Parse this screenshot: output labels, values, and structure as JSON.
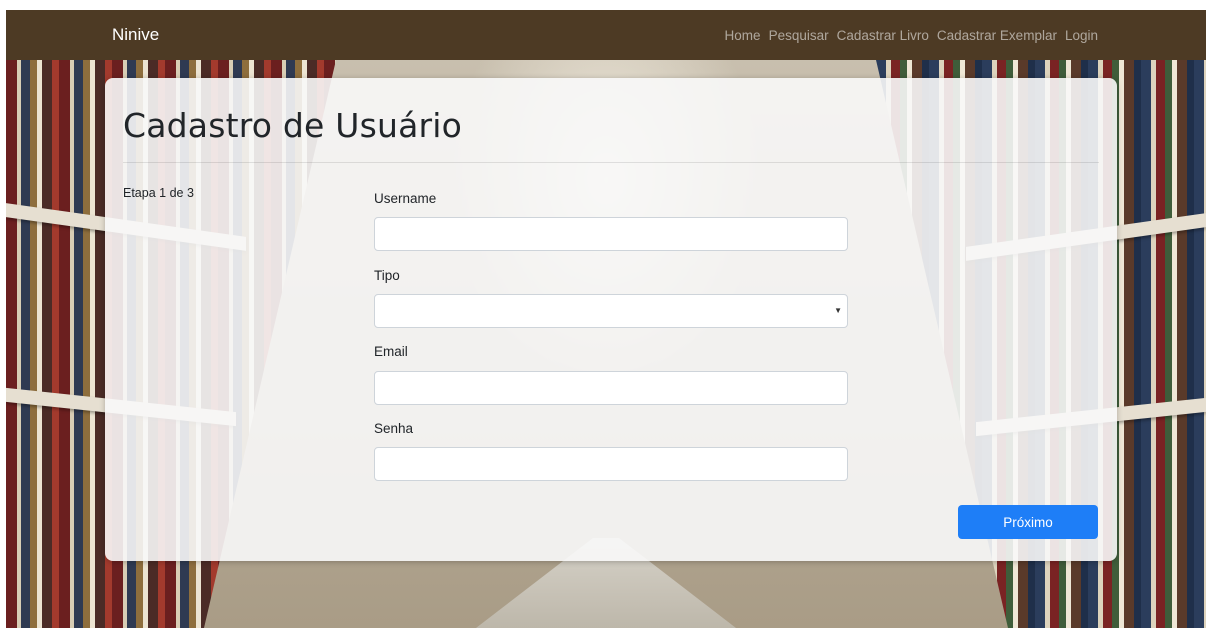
{
  "navbar": {
    "brand": "Ninive",
    "links": [
      "Home",
      "Pesquisar",
      "Cadastrar Livro",
      "Cadastrar Exemplar",
      "Login"
    ]
  },
  "card": {
    "title": "Cadastro de Usuário",
    "step": "Etapa 1 de 3",
    "fields": {
      "username": {
        "label": "Username",
        "value": ""
      },
      "tipo": {
        "label": "Tipo",
        "value": ""
      },
      "email": {
        "label": "Email",
        "value": ""
      },
      "senha": {
        "label": "Senha",
        "value": ""
      }
    },
    "next_label": "Próximo"
  },
  "colors": {
    "navbar_bg": "#4d3a24",
    "primary": "#1e7ef7"
  },
  "icons": {
    "select_caret": "caret-down-icon"
  }
}
